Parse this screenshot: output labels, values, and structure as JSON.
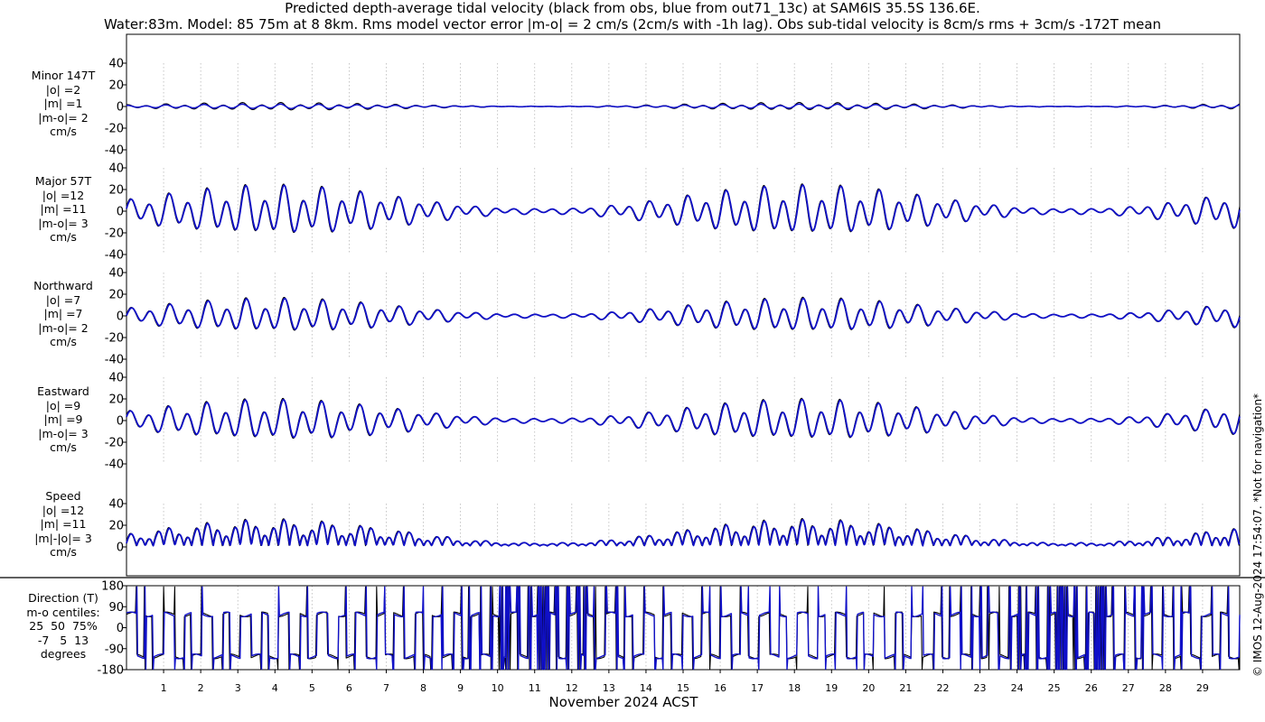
{
  "title_line1": "Predicted depth-average tidal velocity (black from obs, blue from out71_13c) at SAM6IS 35.5S 136.6E.",
  "title_line2": "Water:83m. Model: 85 75m at 8 8km. Rms model vector error |m-o| = 2 cm/s (2cm/s with -1h lag). Obs sub-tidal velocity is 8cm/s rms + 3cm/s -172T mean",
  "xlabel": "November 2024 ACST",
  "credit": "© IMOS 12-Aug-2024 17:54:07. *Not for navigation*",
  "colors": {
    "obs": "#000000",
    "model": "#1010c8",
    "grid": "#b8b8b8",
    "axis": "#000000"
  },
  "chart_data": [
    {
      "type": "line",
      "name": "Minor 147T",
      "label": "Minor 147T\n|o| =2\n|m| =1\n|m-o|= 2\ncm/s",
      "ylim": [
        -40,
        40
      ],
      "yticks": [
        "40",
        "20",
        "0",
        "-20",
        "-40"
      ],
      "amplitude_obs": 3,
      "amplitude_model": 2
    },
    {
      "type": "line",
      "name": "Major 57T",
      "label": "Major 57T\n|o| =12\n|m| =11\n|m-o|= 3\ncm/s",
      "ylim": [
        -40,
        40
      ],
      "yticks": [
        "40",
        "20",
        "0",
        "-20",
        "-40"
      ],
      "amplitude_obs": 22,
      "amplitude_model": 21
    },
    {
      "type": "line",
      "name": "Northward",
      "label": "Northward\n|o| =7\n|m| =7\n|m-o|= 2\ncm/s",
      "ylim": [
        -40,
        40
      ],
      "yticks": [
        "40",
        "20",
        "0",
        "-20",
        "-40"
      ],
      "amplitude_obs": 15,
      "amplitude_model": 14
    },
    {
      "type": "line",
      "name": "Eastward",
      "label": "Eastward\n|o| =9\n|m| =9\n|m-o|= 3\ncm/s",
      "ylim": [
        -40,
        40
      ],
      "yticks": [
        "40",
        "20",
        "0",
        "-20",
        "-40"
      ],
      "amplitude_obs": 18,
      "amplitude_model": 17
    },
    {
      "type": "line",
      "name": "Speed",
      "label": "Speed\n|o| =12\n|m| =11\n|m|-|o|= 3\ncm/s",
      "ylim": [
        0,
        40
      ],
      "yticks": [
        "40",
        "20",
        "0"
      ],
      "amplitude_obs": 22,
      "amplitude_model": 21
    },
    {
      "type": "line",
      "name": "Direction (T)",
      "label": "Direction (T)\nm-o centiles:\n25  50  75%\n-7   5  13\ndegrees",
      "ylim": [
        -180,
        180
      ],
      "yticks": [
        "180",
        "90",
        "0",
        "-90",
        "-180"
      ]
    }
  ],
  "x_axis": {
    "start_day": 0,
    "end_day": 30,
    "tick_labels": [
      "1",
      "2",
      "3",
      "4",
      "5",
      "6",
      "7",
      "8",
      "9",
      "10",
      "11",
      "12",
      "13",
      "14",
      "15",
      "16",
      "17",
      "18",
      "19",
      "20",
      "21",
      "22",
      "23",
      "24",
      "25",
      "26",
      "27",
      "28",
      "29"
    ]
  }
}
